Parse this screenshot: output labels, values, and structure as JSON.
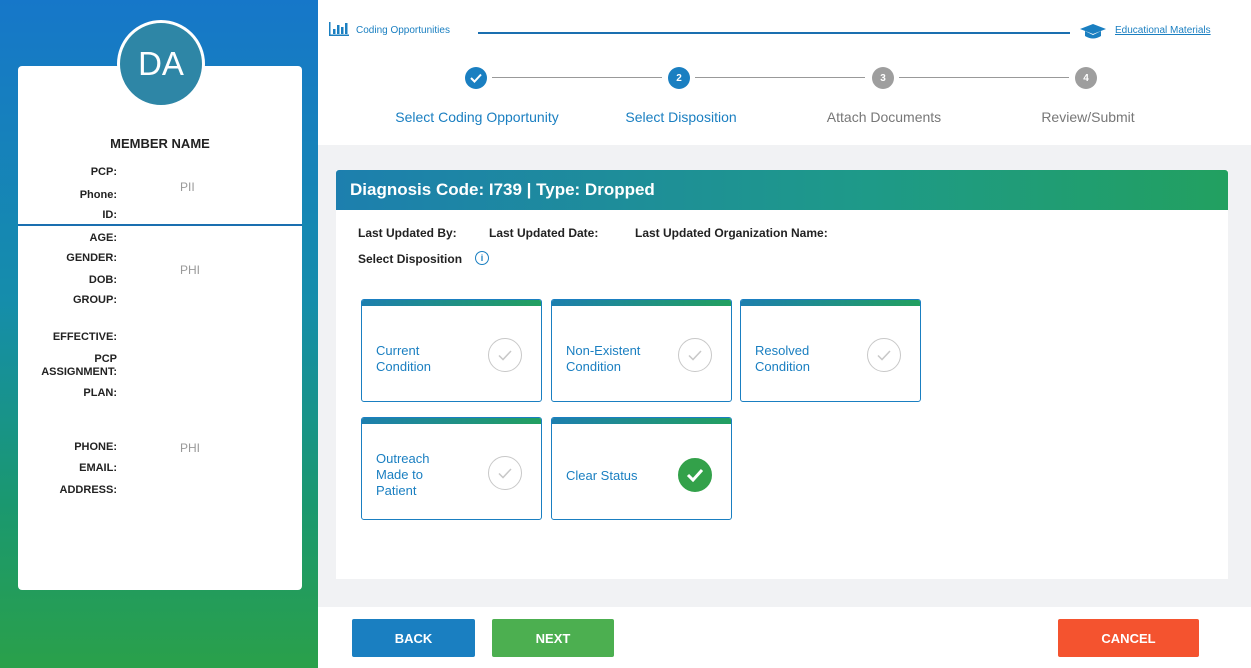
{
  "member": {
    "initials": "DA",
    "name": "MEMBER NAME",
    "group1_labels": [
      "PCP:",
      "Phone:",
      "ID:"
    ],
    "group1_value": "PII",
    "group2_labels": [
      "AGE:",
      "GENDER:",
      "DOB:",
      "GROUP:"
    ],
    "group2_value": "PHI",
    "group3_labels": [
      "EFFECTIVE:",
      "PCP ASSIGNMENT:",
      "PLAN:"
    ],
    "group4_labels": [
      "PHONE:",
      "EMAIL:",
      "ADDRESS:"
    ],
    "group4_value": "PHI"
  },
  "header": {
    "breadcrumb": "Coding Opportunities",
    "educational_link": "Educational Materials"
  },
  "stepper": [
    {
      "number": "1",
      "label": "Select Coding Opportunity",
      "state": "complete"
    },
    {
      "number": "2",
      "label": "Select Disposition",
      "state": "active"
    },
    {
      "number": "3",
      "label": "Attach Documents",
      "state": "pending"
    },
    {
      "number": "4",
      "label": "Review/Submit",
      "state": "pending"
    }
  ],
  "panel": {
    "title": "Diagnosis Code: I739 | Type: Dropped",
    "last_updated_by": "Last Updated By:",
    "last_updated_date": "Last Updated Date:",
    "last_updated_org": "Last Updated Organization Name:",
    "select_disposition": "Select Disposition"
  },
  "dispositions": [
    {
      "label": "Current\nCondition",
      "selected": false
    },
    {
      "label": "Non-Existent\nCondition",
      "selected": false
    },
    {
      "label": "Resolved\nCondition",
      "selected": false
    },
    {
      "label": "Outreach\nMade to\nPatient",
      "selected": false
    },
    {
      "label": "Clear Status",
      "selected": true
    }
  ],
  "buttons": {
    "back": "BACK",
    "next": "NEXT",
    "cancel": "CANCEL"
  },
  "colors": {
    "primary": "#1a7fc1",
    "success": "#4caf50",
    "danger": "#f4532f",
    "pending": "#9e9e9e"
  }
}
